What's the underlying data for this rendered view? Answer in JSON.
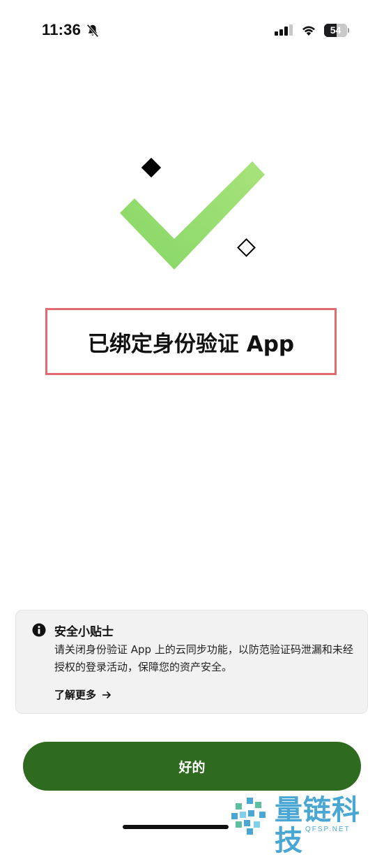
{
  "status_bar": {
    "time": "11:36",
    "battery_level": "54",
    "battery_percent": 54
  },
  "main": {
    "title": "已绑定身份验证 App"
  },
  "tip": {
    "title": "安全小贴士",
    "body": "请关闭身份验证 App 上的云同步功能，以防范验证码泄漏和未经授权的登录活动，保障您的资产安全。",
    "learn_more": "了解更多"
  },
  "actions": {
    "ok_label": "好的"
  },
  "watermark": {
    "text": "量链科技",
    "sub": "QFSP.NET"
  },
  "colors": {
    "primary_button": "#2e6b1e",
    "highlight_border": "#e06a6d",
    "checkmark": "#8ed96a",
    "watermark": "#4aa6d3"
  },
  "icons": {
    "bell": "bell-slash-icon",
    "signal": "cellular-signal-icon",
    "wifi": "wifi-icon",
    "battery": "battery-icon",
    "check": "checkmark-icon",
    "info": "info-icon",
    "arrow": "arrow-right-icon"
  }
}
